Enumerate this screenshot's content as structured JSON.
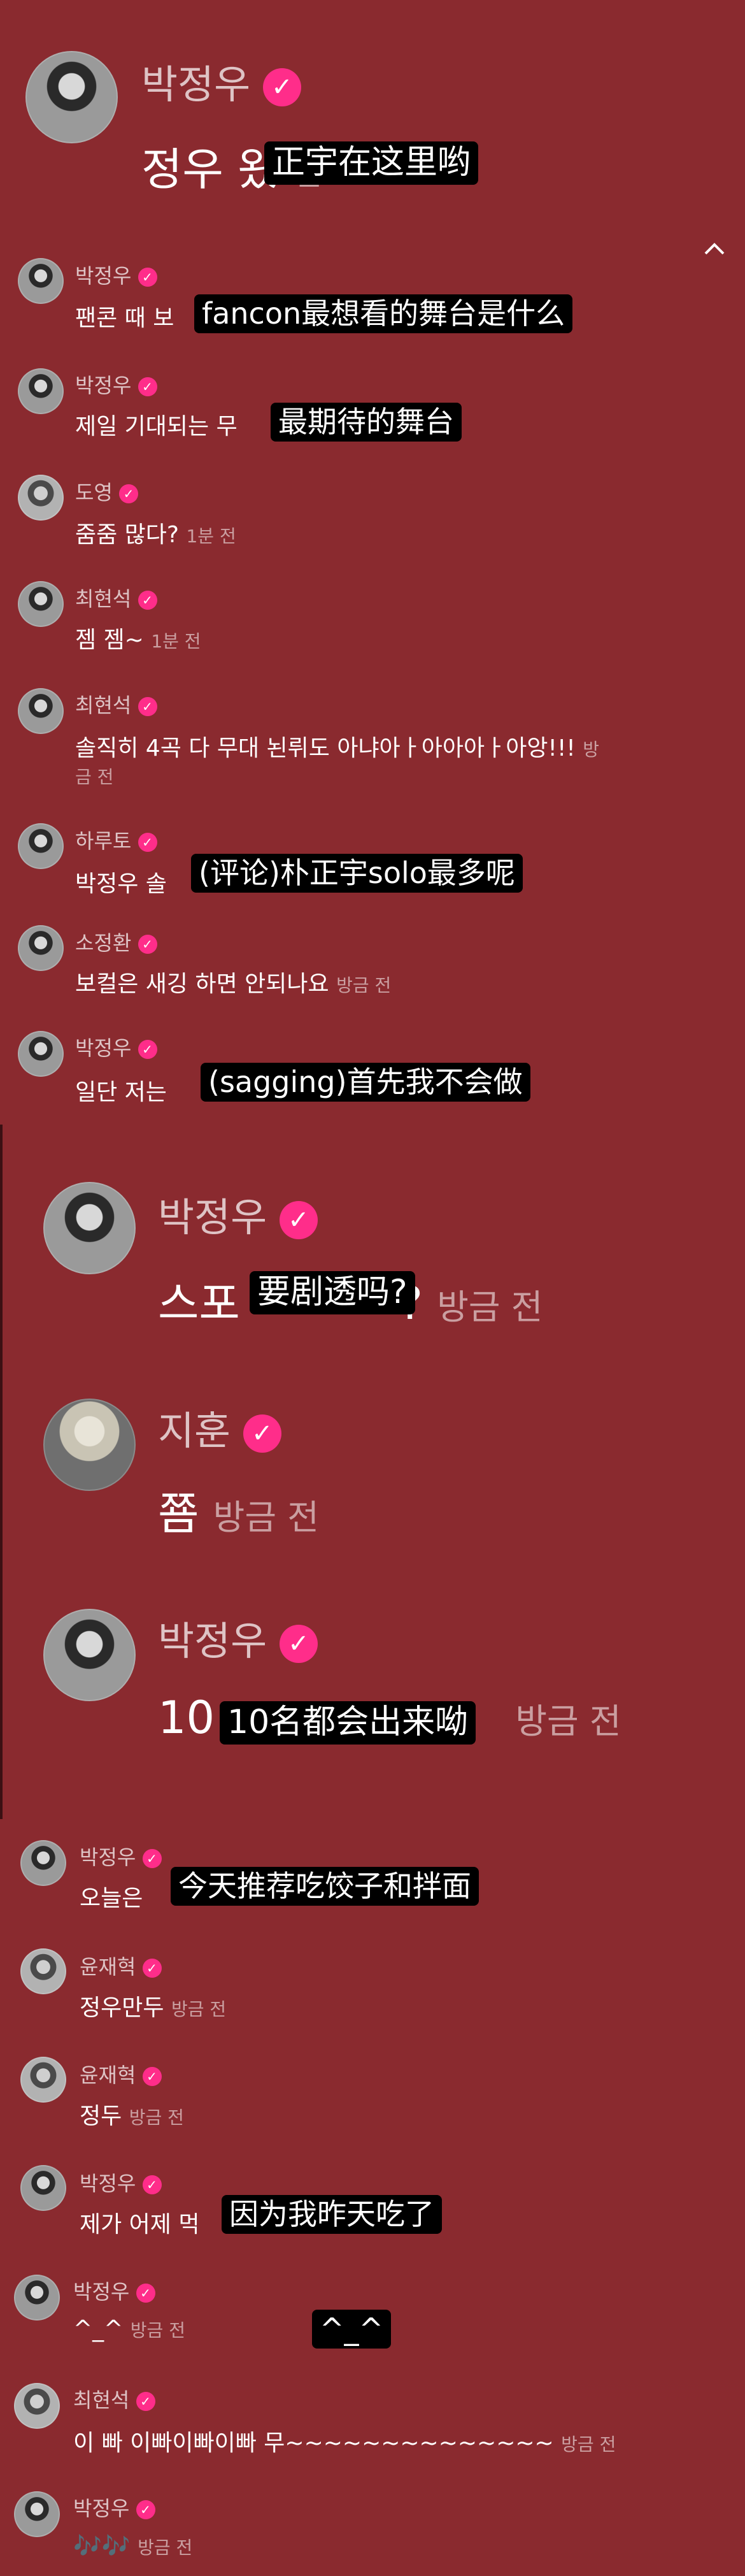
{
  "top": {
    "username": "박정우",
    "message": "정우 왔",
    "time": "전",
    "subtitle": "正宇在这里哟",
    "collapse_icon": "chevron-up-icon"
  },
  "comments_a": [
    {
      "name": "박정우",
      "text": "팬콘 때 보",
      "time": "",
      "subtitle": "fancon最想看的舞台是什么"
    },
    {
      "name": "박정우",
      "text": "제일 기대되는 무",
      "time": "",
      "subtitle": "最期待的舞台"
    },
    {
      "name": "도영",
      "text": "줌줌 많다?",
      "time": "1분 전"
    },
    {
      "name": "최현석",
      "text": "젬 젬~",
      "time": "1분 전"
    },
    {
      "name": "최현석",
      "text": "솔직히 4곡 다 무대 뇐뤼도 아냐아ㅏ아아아ㅏ아앙!!!",
      "text2": "금 전",
      "time": "방"
    },
    {
      "name": "하루토",
      "text": "박정우 솔",
      "time": "",
      "subtitle": "(评论)朴正宇solo最多呢"
    },
    {
      "name": "소정환",
      "text": "보컬은 새깅 하면 안되나요",
      "time": "방금 전"
    },
    {
      "name": "박정우",
      "text": "일단 저는",
      "time": "",
      "subtitle": "(sagging)首先我不会做"
    }
  ],
  "big_comments": [
    {
      "name": "박정우",
      "text": "스포",
      "text_tail": "?",
      "time": "방금 전",
      "subtitle": "要剧透吗?"
    },
    {
      "name": "지훈",
      "text": "쬼",
      "time": "방금 전"
    },
    {
      "name": "박정우",
      "text": "10",
      "time": "방금 전",
      "subtitle": "10名都会出来呦"
    }
  ],
  "comments_b": [
    {
      "name": "박정우",
      "text": "오늘은",
      "time": "",
      "subtitle": "今天推荐吃饺子和拌面"
    },
    {
      "name": "윤재혁",
      "text": "정우만두",
      "time": "방금 전"
    },
    {
      "name": "윤재혁",
      "text": "정두",
      "time": "방금 전"
    },
    {
      "name": "박정우",
      "text": "제가 어제 먹",
      "time": "",
      "subtitle": "因为我昨天吃了"
    },
    {
      "name": "박정우",
      "text": "^_^",
      "time": "방금 전",
      "subtitle": "^_^"
    },
    {
      "name": "최현석",
      "text": "이 빠 이빠이빠이빠 무~~~~~~~~~~~~~~",
      "time": "방금 전"
    },
    {
      "name": "박정우",
      "text": "🎶🎶",
      "time": "방금 전"
    }
  ],
  "verified_badge": "verified-check-icon",
  "colors": {
    "background": "#8a2a2f",
    "badge": "#ff2d8a",
    "subtitle_bg": "#000000"
  }
}
